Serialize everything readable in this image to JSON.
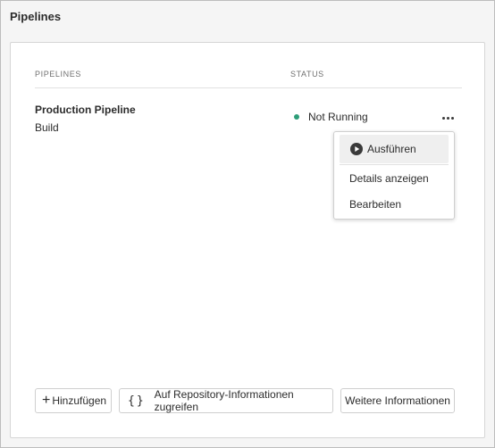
{
  "page": {
    "title": "Pipelines"
  },
  "table": {
    "headers": {
      "pipelines": "PIPELINES",
      "status": "STATUS"
    },
    "rows": [
      {
        "name": "Production Pipeline",
        "type": "Build",
        "status": "Not Running",
        "status_color": "#2d9d78"
      }
    ]
  },
  "menu": {
    "items": [
      {
        "label": "Ausführen",
        "icon": "play-circle-icon"
      },
      {
        "label": "Details anzeigen"
      },
      {
        "label": "Bearbeiten"
      }
    ]
  },
  "footer": {
    "add_label": "Hinzufügen",
    "add_icon": "plus-icon",
    "repo_label": "Auf Repository-Informationen zugreifen",
    "repo_icon": "braces-icon",
    "info_label": "Weitere Informationen"
  }
}
